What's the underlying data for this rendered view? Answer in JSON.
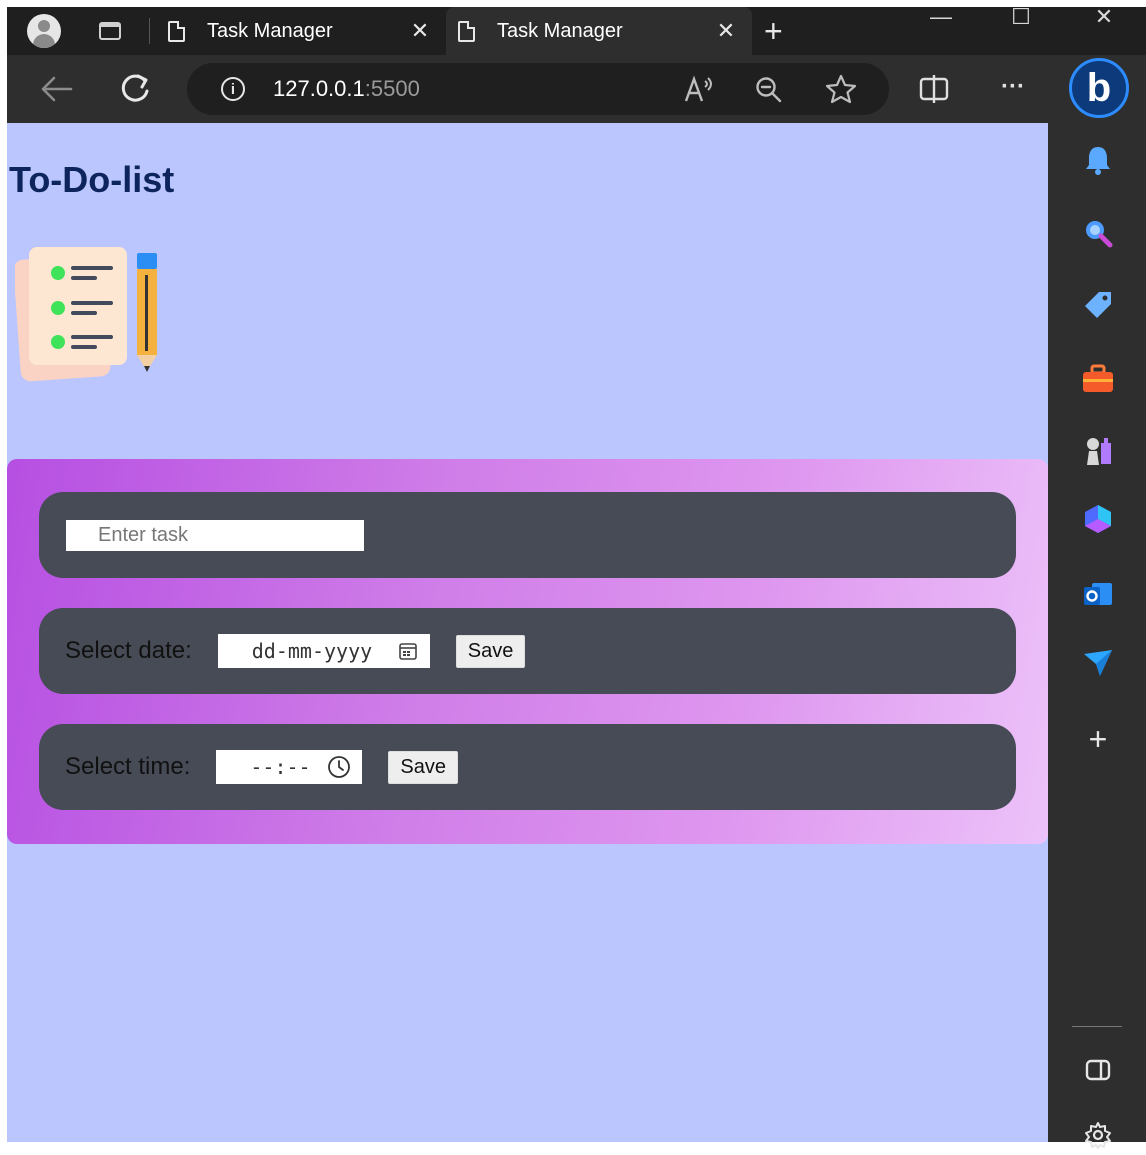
{
  "browser": {
    "tabs": [
      {
        "title": "Task Manager",
        "active": false
      },
      {
        "title": "Task Manager",
        "active": true
      }
    ],
    "tab_close_glyph": "✕",
    "new_tab_glyph": "+",
    "window": {
      "minimize": "—",
      "maximize": "☐",
      "close": "✕"
    },
    "url_host": "127.0.0.1",
    "url_port": ":5500",
    "toolbar_icons": [
      "back-arrow-icon",
      "refresh-icon",
      "site-info-icon",
      "read-aloud-icon",
      "zoom-out-icon",
      "favorite-star-icon",
      "split-screen-icon",
      "more-icon",
      "bing-copilot-icon"
    ],
    "more_glyph": "···"
  },
  "sidebar": {
    "icons": [
      "bell-icon",
      "search-icon",
      "shopping-tag-icon",
      "tools-icon",
      "chess-games-icon",
      "microsoft-365-icon",
      "outlook-icon",
      "send-drop-icon",
      "add-icon",
      "sidebar-toggle-icon",
      "settings-icon"
    ],
    "add_glyph": "+"
  },
  "page": {
    "title": "To-Do-list",
    "task_placeholder": "Enter task",
    "date_label": "Select date:",
    "date_placeholder": "dd-mm-yyyy",
    "time_label": "Select time:",
    "time_placeholder": "--:--",
    "save_label": "Save"
  },
  "colors": {
    "page_background": "#bac6fd",
    "title": "#0e245c",
    "panel_gradient_start": "#b64fe2",
    "panel_gradient_end": "#ecc2f9",
    "row_background": "#464b56",
    "chrome_dark": "#1f1f1f"
  }
}
